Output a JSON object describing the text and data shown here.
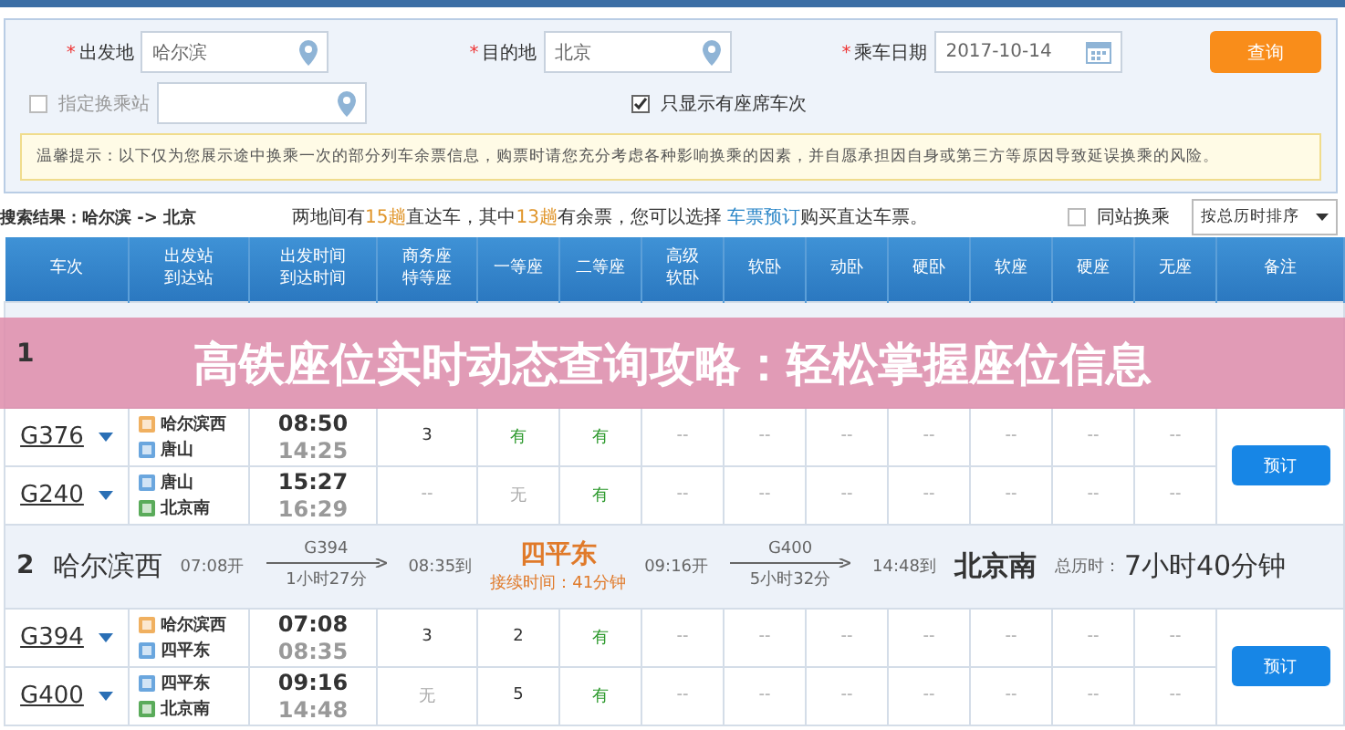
{
  "search_form": {
    "from": {
      "label": "出发地",
      "required_mark": "*",
      "value": "哈尔滨"
    },
    "to": {
      "label": "目的地",
      "required_mark": "*",
      "value": "北京"
    },
    "date": {
      "label": "乘车日期",
      "required_mark": "*",
      "value": "2017-10-14"
    },
    "query_button": "查询",
    "transfer_station": {
      "label": "指定换乘站",
      "checked": false
    },
    "only_seats": {
      "label": "只显示有座席车次",
      "checked": true
    },
    "notice": "温馨提示：以下仅为您展示途中换乘一次的部分列车余票信息，购票时请您充分考虑各种影响换乘的因素，并自愿承担因自身或第三方等原因导致延误换乘的风险。"
  },
  "results_bar": {
    "summary": "搜索结果：哈尔滨 -> 北京",
    "sentence": [
      {
        "kind": "plain",
        "text": "两地间有"
      },
      {
        "kind": "highlight",
        "text": "15趟"
      },
      {
        "kind": "plain",
        "text": "直达车，其中"
      },
      {
        "kind": "highlight",
        "text": "13趟"
      },
      {
        "kind": "plain",
        "text": "有余票，您可以选择 "
      },
      {
        "kind": "link",
        "text": "车票预订"
      },
      {
        "kind": "plain",
        "text": "购买直达车票。"
      }
    ],
    "same_station": {
      "label": "同站换乘",
      "checked": false
    },
    "sort_select": "按总历时排序"
  },
  "table": {
    "columns": [
      [
        "车次"
      ],
      [
        "出发站",
        "到达站"
      ],
      [
        "出发时间",
        "到达时间"
      ],
      [
        "商务座",
        "特等座"
      ],
      [
        "一等座"
      ],
      [
        "二等座"
      ],
      [
        "高级",
        "软卧"
      ],
      [
        "软卧"
      ],
      [
        "动卧"
      ],
      [
        "硬卧"
      ],
      [
        "软座"
      ],
      [
        "硬座"
      ],
      [
        "无座"
      ],
      [
        "备注"
      ]
    ],
    "groups": [
      {
        "number": "1",
        "book_button": "预订",
        "rows": [
          {
            "train": "G376",
            "from": {
              "name": "哈尔滨西",
              "kind": "start"
            },
            "to": {
              "name": "唐山",
              "kind": "pass"
            },
            "depart": "08:50",
            "arrive": "14:25",
            "seats": [
              {
                "value": "3",
                "kind": "count"
              },
              {
                "value": "有",
                "kind": "available"
              },
              {
                "value": "有",
                "kind": "available"
              },
              {
                "value": "--",
                "kind": "none"
              },
              {
                "value": "--",
                "kind": "none"
              },
              {
                "value": "--",
                "kind": "none"
              },
              {
                "value": "--",
                "kind": "none"
              },
              {
                "value": "--",
                "kind": "none"
              },
              {
                "value": "--",
                "kind": "none"
              },
              {
                "value": "--",
                "kind": "none"
              }
            ]
          },
          {
            "train": "G240",
            "from": {
              "name": "唐山",
              "kind": "pass"
            },
            "to": {
              "name": "北京南",
              "kind": "end"
            },
            "depart": "15:27",
            "arrive": "16:29",
            "seats": [
              {
                "value": "--",
                "kind": "none"
              },
              {
                "value": "无",
                "kind": "none"
              },
              {
                "value": "有",
                "kind": "available"
              },
              {
                "value": "--",
                "kind": "none"
              },
              {
                "value": "--",
                "kind": "none"
              },
              {
                "value": "--",
                "kind": "none"
              },
              {
                "value": "--",
                "kind": "none"
              },
              {
                "value": "--",
                "kind": "none"
              },
              {
                "value": "--",
                "kind": "none"
              },
              {
                "value": "--",
                "kind": "none"
              }
            ]
          }
        ]
      },
      {
        "number": "2",
        "from": "哈尔滨西",
        "depart": "07:08开",
        "leg1": {
          "train": "G394",
          "duration": "1小时27分"
        },
        "arrive1": "08:35到",
        "transfer": "四平东",
        "connection": "接续时间：41分钟",
        "depart2": "09:16开",
        "leg2": {
          "train": "G400",
          "duration": "5小时32分"
        },
        "arrive2": "14:48到",
        "to": "北京南",
        "total_label": "总历时：",
        "total": "7小时40分钟",
        "book_button": "预订",
        "rows": [
          {
            "train": "G394",
            "from": {
              "name": "哈尔滨西",
              "kind": "start"
            },
            "to": {
              "name": "四平东",
              "kind": "pass"
            },
            "depart": "07:08",
            "arrive": "08:35",
            "seats": [
              {
                "value": "3",
                "kind": "count"
              },
              {
                "value": "2",
                "kind": "count"
              },
              {
                "value": "有",
                "kind": "available"
              },
              {
                "value": "--",
                "kind": "none"
              },
              {
                "value": "--",
                "kind": "none"
              },
              {
                "value": "--",
                "kind": "none"
              },
              {
                "value": "--",
                "kind": "none"
              },
              {
                "value": "--",
                "kind": "none"
              },
              {
                "value": "--",
                "kind": "none"
              },
              {
                "value": "--",
                "kind": "none"
              }
            ]
          },
          {
            "train": "G400",
            "from": {
              "name": "四平东",
              "kind": "pass"
            },
            "to": {
              "name": "北京南",
              "kind": "end"
            },
            "depart": "09:16",
            "arrive": "14:48",
            "seats": [
              {
                "value": "无",
                "kind": "none"
              },
              {
                "value": "5",
                "kind": "count"
              },
              {
                "value": "有",
                "kind": "available"
              },
              {
                "value": "--",
                "kind": "none"
              },
              {
                "value": "--",
                "kind": "none"
              },
              {
                "value": "--",
                "kind": "none"
              },
              {
                "value": "--",
                "kind": "none"
              },
              {
                "value": "--",
                "kind": "none"
              },
              {
                "value": "--",
                "kind": "none"
              },
              {
                "value": "--",
                "kind": "none"
              }
            ]
          }
        ]
      }
    ]
  },
  "overlay_title": "高铁座位实时动态查询攻略：轻松掌握座位信息"
}
